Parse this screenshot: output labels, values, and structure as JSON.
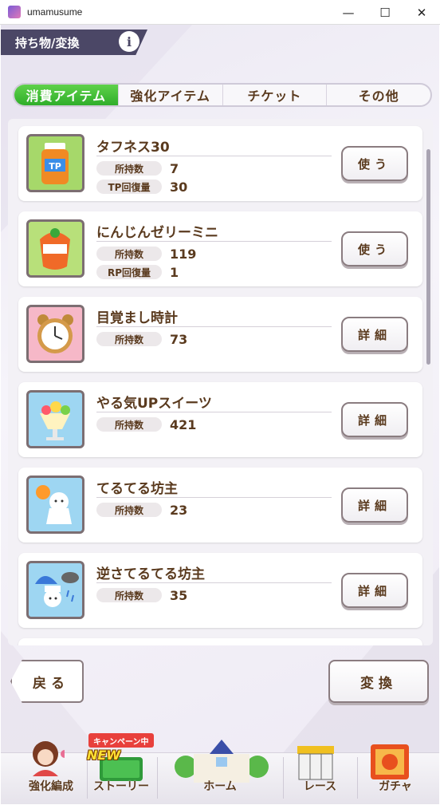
{
  "window": {
    "title": "umamusume",
    "minimize": "—",
    "maximize": "☐",
    "close": "✕"
  },
  "header": {
    "title": "持ち物/変換",
    "info_label": "i"
  },
  "tabs": [
    {
      "label": "消費アイテム",
      "active": true
    },
    {
      "label": "強化アイテム",
      "active": false
    },
    {
      "label": "チケット",
      "active": false
    },
    {
      "label": "その他",
      "active": false
    }
  ],
  "items": [
    {
      "name": "タフネス30",
      "icon": "tp-drink-icon",
      "stats": [
        {
          "label": "所持数",
          "value": "7"
        },
        {
          "label": "TP回復量",
          "value": "30"
        }
      ],
      "action": "使う"
    },
    {
      "name": "にんじんゼリーミニ",
      "icon": "carrot-jelly-icon",
      "stats": [
        {
          "label": "所持数",
          "value": "119"
        },
        {
          "label": "RP回復量",
          "value": "1"
        }
      ],
      "action": "使う"
    },
    {
      "name": "目覚まし時計",
      "icon": "alarm-clock-icon",
      "stats": [
        {
          "label": "所持数",
          "value": "73"
        }
      ],
      "action": "詳細"
    },
    {
      "name": "やる気UPスイーツ",
      "icon": "parfait-icon",
      "stats": [
        {
          "label": "所持数",
          "value": "421"
        }
      ],
      "action": "詳細"
    },
    {
      "name": "てるてる坊主",
      "icon": "teru-teru-bozu-icon",
      "stats": [
        {
          "label": "所持数",
          "value": "23"
        }
      ],
      "action": "詳細"
    },
    {
      "name": "逆さてるてる坊主",
      "icon": "reverse-teru-teru-bozu-icon",
      "stats": [
        {
          "label": "所持数",
          "value": "35"
        }
      ],
      "action": "詳細"
    }
  ],
  "footer": {
    "back": "戻る",
    "convert": "変換"
  },
  "nav": {
    "campaign_badge": "キャンペーン中",
    "new_badge": "NEW",
    "items": [
      {
        "label": "強化編成"
      },
      {
        "label": "ストーリー"
      },
      {
        "label": "ホーム"
      },
      {
        "label": "レース"
      },
      {
        "label": "ガチャ"
      }
    ]
  },
  "colors": {
    "accent_green": "#2fae2a",
    "text_brown": "#5a3a1e",
    "header_dark": "#4b4766"
  }
}
